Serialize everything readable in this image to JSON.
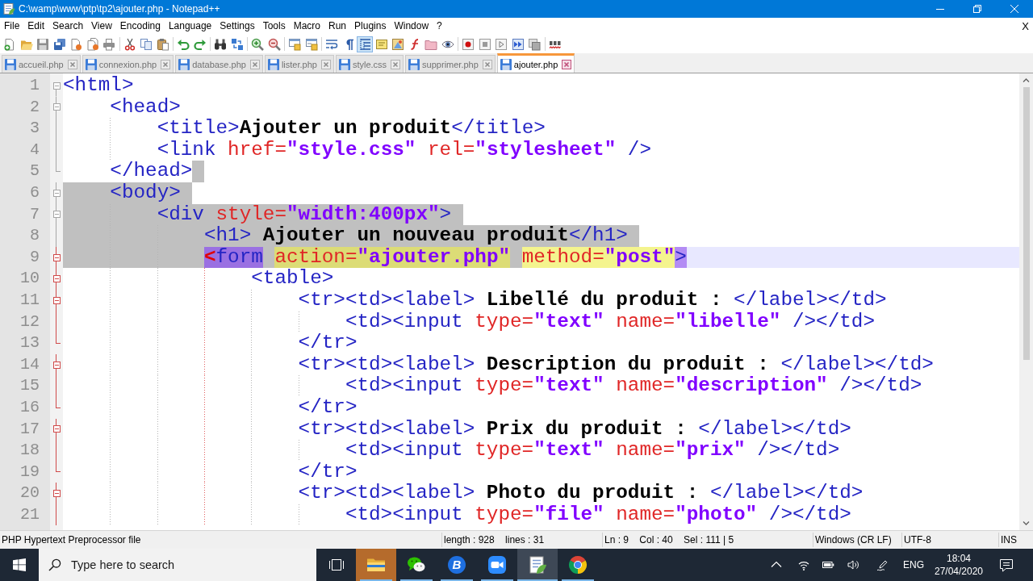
{
  "window": {
    "title": "C:\\wamp\\www\\ptp\\tp2\\ajouter.php - Notepad++"
  },
  "menu": {
    "items": [
      "File",
      "Edit",
      "Search",
      "View",
      "Encoding",
      "Language",
      "Settings",
      "Tools",
      "Macro",
      "Run",
      "Plugins",
      "Window",
      "?"
    ],
    "close_document": "X"
  },
  "toolbar": [
    [
      {
        "kind": "new",
        "pressed": false
      },
      {
        "kind": "open",
        "pressed": false
      },
      {
        "kind": "save",
        "pressed": false
      },
      {
        "kind": "saveall",
        "pressed": false
      },
      {
        "kind": "close",
        "pressed": false
      },
      {
        "kind": "closeall",
        "pressed": false
      },
      {
        "kind": "print",
        "pressed": false
      }
    ],
    [
      {
        "kind": "cut",
        "pressed": false
      },
      {
        "kind": "copy",
        "pressed": false
      },
      {
        "kind": "paste",
        "pressed": false
      }
    ],
    [
      {
        "kind": "undo",
        "pressed": false
      },
      {
        "kind": "redo",
        "pressed": false
      }
    ],
    [
      {
        "kind": "find",
        "pressed": false
      },
      {
        "kind": "replace",
        "pressed": false
      }
    ],
    [
      {
        "kind": "zoomin",
        "pressed": false
      },
      {
        "kind": "zoomout",
        "pressed": false
      }
    ],
    [
      {
        "kind": "syncv",
        "pressed": false
      },
      {
        "kind": "synch",
        "pressed": false
      }
    ],
    [
      {
        "kind": "wrap",
        "pressed": false
      },
      {
        "kind": "allchars",
        "pressed": false
      },
      {
        "kind": "indentguide",
        "pressed": true
      },
      {
        "kind": "udl",
        "pressed": false
      },
      {
        "kind": "docmap",
        "pressed": false
      },
      {
        "kind": "funclist",
        "pressed": false
      },
      {
        "kind": "workspace",
        "pressed": false
      },
      {
        "kind": "monitor",
        "pressed": false
      }
    ],
    [
      {
        "kind": "record",
        "pressed": false
      },
      {
        "kind": "stop",
        "pressed": false
      },
      {
        "kind": "play",
        "pressed": false
      },
      {
        "kind": "playmulti",
        "pressed": false
      },
      {
        "kind": "savemacro",
        "pressed": false
      }
    ],
    [
      {
        "kind": "spellcheck",
        "pressed": false
      }
    ]
  ],
  "tabs": [
    {
      "label": "accueil.php",
      "selected": false
    },
    {
      "label": "connexion.php",
      "selected": false
    },
    {
      "label": "database.php",
      "selected": false
    },
    {
      "label": "lister.php",
      "selected": false
    },
    {
      "label": "style.css",
      "selected": false
    },
    {
      "label": "supprimer.php",
      "selected": false
    },
    {
      "label": "ajouter.php",
      "selected": true
    }
  ],
  "editor": {
    "lines": [
      {
        "number": "1",
        "kind": "open",
        "fold_active": false,
        "current": false,
        "eol_selected": false,
        "segments": [
          {
            "text": "<html>",
            "kind": "tag",
            "selected": false,
            "highlighted": false
          }
        ],
        "children": [
          {
            "number": "2",
            "kind": "open",
            "fold_active": false,
            "current": false,
            "indent_selected": false,
            "eol_selected": false,
            "segments": [
              {
                "text": "<head>",
                "kind": "tag",
                "selected": false,
                "highlighted": false
              }
            ],
            "children": [
              {
                "number": "3",
                "kind": "plain",
                "fold_active": false,
                "current": false,
                "indent_selected": false,
                "eol_selected": false,
                "segments": [
                  {
                    "text": "<title>",
                    "kind": "tag",
                    "selected": false,
                    "highlighted": false
                  },
                  {
                    "text": "Ajouter un produit",
                    "kind": "text",
                    "selected": false,
                    "highlighted": false
                  },
                  {
                    "text": "</title>",
                    "kind": "tag",
                    "selected": false,
                    "highlighted": false
                  }
                ]
              },
              {
                "number": "4",
                "kind": "plain",
                "fold_active": false,
                "current": false,
                "indent_selected": false,
                "eol_selected": false,
                "segments": [
                  {
                    "text": "<link ",
                    "kind": "tag",
                    "selected": false,
                    "highlighted": false
                  },
                  {
                    "text": "href=",
                    "kind": "attr",
                    "selected": false,
                    "highlighted": false
                  },
                  {
                    "text": "\"style.css\"",
                    "kind": "string",
                    "selected": false,
                    "highlighted": false
                  },
                  {
                    "text": " rel=",
                    "kind": "attr",
                    "selected": false,
                    "highlighted": false
                  },
                  {
                    "text": "\"stylesheet\"",
                    "kind": "string",
                    "selected": false,
                    "highlighted": false
                  },
                  {
                    "text": " />",
                    "kind": "tag",
                    "selected": false,
                    "highlighted": false
                  }
                ]
              }
            ]
          },
          {
            "number": "5",
            "kind": "close",
            "fold_active": false,
            "current": false,
            "indent_selected": false,
            "eol_selected": true,
            "segments": [
              {
                "text": "</head>",
                "kind": "tag",
                "selected": false,
                "highlighted": false
              }
            ]
          },
          {
            "number": "6",
            "kind": "open",
            "fold_active": false,
            "current": false,
            "indent_selected": true,
            "eol_selected": true,
            "segments": [
              {
                "text": "<body>",
                "kind": "tag",
                "selected": true,
                "highlighted": false
              }
            ],
            "children": [
              {
                "number": "7",
                "kind": "open",
                "fold_active": false,
                "current": false,
                "indent_selected": true,
                "eol_selected": true,
                "segments": [
                  {
                    "text": "<div ",
                    "kind": "tag",
                    "selected": true,
                    "highlighted": false
                  },
                  {
                    "text": "style=",
                    "kind": "attr",
                    "selected": true,
                    "highlighted": false
                  },
                  {
                    "text": "\"width:400px\"",
                    "kind": "string",
                    "selected": true,
                    "highlighted": false
                  },
                  {
                    "text": ">",
                    "kind": "tag",
                    "selected": true,
                    "highlighted": false
                  }
                ],
                "children": [
                  {
                    "number": "8",
                    "kind": "plain",
                    "fold_active": false,
                    "current": false,
                    "indent_selected": true,
                    "eol_selected": true,
                    "segments": [
                      {
                        "text": "<h1>",
                        "kind": "tag",
                        "selected": true,
                        "highlighted": false
                      },
                      {
                        "text": " Ajouter un nouveau produit",
                        "kind": "text",
                        "selected": true,
                        "highlighted": false
                      },
                      {
                        "text": "</h1>",
                        "kind": "tag",
                        "selected": true,
                        "highlighted": false
                      }
                    ]
                  },
                  {
                    "number": "9",
                    "kind": "open",
                    "fold_active": true,
                    "current": true,
                    "indent_selected": true,
                    "eol_selected": false,
                    "segments": [
                      {
                        "text": "<",
                        "kind": "punct",
                        "selected": true,
                        "highlighted": true
                      },
                      {
                        "text": "form ",
                        "kind": "tag",
                        "selected": true,
                        "highlighted": true
                      },
                      {
                        "text": "action=",
                        "kind": "attr",
                        "selected": true,
                        "highlighted": true
                      },
                      {
                        "text": "\"ajouter.php\" ",
                        "kind": "string",
                        "selected": true,
                        "highlighted": true
                      },
                      {
                        "text": "method=",
                        "kind": "attr",
                        "selected": false,
                        "highlighted": true
                      },
                      {
                        "text": "\"post\"",
                        "kind": "string",
                        "selected": false,
                        "highlighted": true
                      },
                      {
                        "text": ">",
                        "kind": "tag",
                        "selected": false,
                        "highlighted": true
                      }
                    ],
                    "children": [
                      {
                        "number": "10",
                        "kind": "open",
                        "fold_active": true,
                        "current": false,
                        "indent_selected": false,
                        "eol_selected": false,
                        "segments": [
                          {
                            "text": "<table>",
                            "kind": "tag",
                            "selected": false,
                            "highlighted": false
                          }
                        ],
                        "children": [
                          {
                            "number": "11",
                            "kind": "open",
                            "fold_active": true,
                            "current": false,
                            "indent_selected": false,
                            "eol_selected": false,
                            "segments": [
                              {
                                "text": "<tr><td><label>",
                                "kind": "tag",
                                "selected": false,
                                "highlighted": false
                              },
                              {
                                "text": " Libellé du produit : ",
                                "kind": "text",
                                "selected": false,
                                "highlighted": false
                              },
                              {
                                "text": "</label></td>",
                                "kind": "tag",
                                "selected": false,
                                "highlighted": false
                              }
                            ],
                            "children": [
                              {
                                "number": "12",
                                "kind": "plain",
                                "fold_active": true,
                                "current": false,
                                "indent_selected": false,
                                "eol_selected": false,
                                "segments": [
                                  {
                                    "text": "<td><input ",
                                    "kind": "tag",
                                    "selected": false,
                                    "highlighted": false
                                  },
                                  {
                                    "text": "type=",
                                    "kind": "attr",
                                    "selected": false,
                                    "highlighted": false
                                  },
                                  {
                                    "text": "\"text\"",
                                    "kind": "string",
                                    "selected": false,
                                    "highlighted": false
                                  },
                                  {
                                    "text": " name=",
                                    "kind": "attr",
                                    "selected": false,
                                    "highlighted": false
                                  },
                                  {
                                    "text": "\"libelle\"",
                                    "kind": "string",
                                    "selected": false,
                                    "highlighted": false
                                  },
                                  {
                                    "text": " /></td>",
                                    "kind": "tag",
                                    "selected": false,
                                    "highlighted": false
                                  }
                                ]
                              }
                            ]
                          },
                          {
                            "number": "13",
                            "kind": "close",
                            "fold_active": true,
                            "current": false,
                            "indent_selected": false,
                            "eol_selected": false,
                            "segments": [
                              {
                                "text": "</tr>",
                                "kind": "tag",
                                "selected": false,
                                "highlighted": false
                              }
                            ]
                          },
                          {
                            "number": "14",
                            "kind": "open",
                            "fold_active": true,
                            "current": false,
                            "indent_selected": false,
                            "eol_selected": false,
                            "segments": [
                              {
                                "text": "<tr><td><label>",
                                "kind": "tag",
                                "selected": false,
                                "highlighted": false
                              },
                              {
                                "text": " Description du produit : ",
                                "kind": "text",
                                "selected": false,
                                "highlighted": false
                              },
                              {
                                "text": "</label></td>",
                                "kind": "tag",
                                "selected": false,
                                "highlighted": false
                              }
                            ],
                            "children": [
                              {
                                "number": "15",
                                "kind": "plain",
                                "fold_active": true,
                                "current": false,
                                "indent_selected": false,
                                "eol_selected": false,
                                "segments": [
                                  {
                                    "text": "<td><input ",
                                    "kind": "tag",
                                    "selected": false,
                                    "highlighted": false
                                  },
                                  {
                                    "text": "type=",
                                    "kind": "attr",
                                    "selected": false,
                                    "highlighted": false
                                  },
                                  {
                                    "text": "\"text\"",
                                    "kind": "string",
                                    "selected": false,
                                    "highlighted": false
                                  },
                                  {
                                    "text": " name=",
                                    "kind": "attr",
                                    "selected": false,
                                    "highlighted": false
                                  },
                                  {
                                    "text": "\"description\"",
                                    "kind": "string",
                                    "selected": false,
                                    "highlighted": false
                                  },
                                  {
                                    "text": " /></td>",
                                    "kind": "tag",
                                    "selected": false,
                                    "highlighted": false
                                  }
                                ]
                              }
                            ]
                          },
                          {
                            "number": "16",
                            "kind": "close",
                            "fold_active": true,
                            "current": false,
                            "indent_selected": false,
                            "eol_selected": false,
                            "segments": [
                              {
                                "text": "</tr>",
                                "kind": "tag",
                                "selected": false,
                                "highlighted": false
                              }
                            ]
                          },
                          {
                            "number": "17",
                            "kind": "open",
                            "fold_active": true,
                            "current": false,
                            "indent_selected": false,
                            "eol_selected": false,
                            "segments": [
                              {
                                "text": "<tr><td><label>",
                                "kind": "tag",
                                "selected": false,
                                "highlighted": false
                              },
                              {
                                "text": " Prix du produit : ",
                                "kind": "text",
                                "selected": false,
                                "highlighted": false
                              },
                              {
                                "text": "</label></td>",
                                "kind": "tag",
                                "selected": false,
                                "highlighted": false
                              }
                            ],
                            "children": [
                              {
                                "number": "18",
                                "kind": "plain",
                                "fold_active": true,
                                "current": false,
                                "indent_selected": false,
                                "eol_selected": false,
                                "segments": [
                                  {
                                    "text": "<td><input ",
                                    "kind": "tag",
                                    "selected": false,
                                    "highlighted": false
                                  },
                                  {
                                    "text": "type=",
                                    "kind": "attr",
                                    "selected": false,
                                    "highlighted": false
                                  },
                                  {
                                    "text": "\"text\"",
                                    "kind": "string",
                                    "selected": false,
                                    "highlighted": false
                                  },
                                  {
                                    "text": " name=",
                                    "kind": "attr",
                                    "selected": false,
                                    "highlighted": false
                                  },
                                  {
                                    "text": "\"prix\"",
                                    "kind": "string",
                                    "selected": false,
                                    "highlighted": false
                                  },
                                  {
                                    "text": " /></td>",
                                    "kind": "tag",
                                    "selected": false,
                                    "highlighted": false
                                  }
                                ]
                              }
                            ]
                          },
                          {
                            "number": "19",
                            "kind": "close",
                            "fold_active": true,
                            "current": false,
                            "indent_selected": false,
                            "eol_selected": false,
                            "segments": [
                              {
                                "text": "</tr>",
                                "kind": "tag",
                                "selected": false,
                                "highlighted": false
                              }
                            ]
                          },
                          {
                            "number": "20",
                            "kind": "open",
                            "fold_active": true,
                            "current": false,
                            "indent_selected": false,
                            "eol_selected": false,
                            "segments": [
                              {
                                "text": "<tr><td><label>",
                                "kind": "tag",
                                "selected": false,
                                "highlighted": false
                              },
                              {
                                "text": " Photo du produit : ",
                                "kind": "text",
                                "selected": false,
                                "highlighted": false
                              },
                              {
                                "text": "</label></td>",
                                "kind": "tag",
                                "selected": false,
                                "highlighted": false
                              }
                            ],
                            "children": [
                              {
                                "number": "21",
                                "kind": "plain",
                                "fold_active": true,
                                "current": false,
                                "indent_selected": false,
                                "eol_selected": false,
                                "segments": [
                                  {
                                    "text": "<td><input ",
                                    "kind": "tag",
                                    "selected": false,
                                    "highlighted": false
                                  },
                                  {
                                    "text": "type=",
                                    "kind": "attr",
                                    "selected": false,
                                    "highlighted": false
                                  },
                                  {
                                    "text": "\"file\"",
                                    "kind": "string",
                                    "selected": false,
                                    "highlighted": false
                                  },
                                  {
                                    "text": " name=",
                                    "kind": "attr",
                                    "selected": false,
                                    "highlighted": false
                                  },
                                  {
                                    "text": "\"photo\"",
                                    "kind": "string",
                                    "selected": false,
                                    "highlighted": false
                                  },
                                  {
                                    "text": " /></td>",
                                    "kind": "tag",
                                    "selected": false,
                                    "highlighted": false
                                  }
                                ]
                              }
                            ]
                          }
                        ]
                      }
                    ]
                  }
                ]
              }
            ]
          }
        ]
      }
    ]
  },
  "status_bar": {
    "file_type": "PHP Hypertext Preprocessor file",
    "document": "length : 928    lines : 31",
    "position": "Ln : 9    Col : 40    Sel : 111 | 5",
    "eol": "Windows (CR LF)",
    "encoding": "UTF-8",
    "mode": "INS"
  },
  "taskbar": {
    "search_placeholder": "Type here to search",
    "apps": [
      {
        "kind": "folder",
        "running": true,
        "flashing": true,
        "selected": false
      },
      {
        "kind": "chat",
        "running": true,
        "flashing": false,
        "selected": false
      },
      {
        "kind": "letter",
        "glyph": "B",
        "running": true,
        "flashing": false,
        "selected": false
      },
      {
        "kind": "camera",
        "running": true,
        "flashing": false,
        "selected": false
      },
      {
        "kind": "notepad",
        "running": true,
        "flashing": false,
        "selected": true
      },
      {
        "kind": "browser",
        "running": true,
        "flashing": false,
        "selected": false
      }
    ],
    "language": "ENG",
    "time": "18:04",
    "date": "27/04/2020"
  }
}
